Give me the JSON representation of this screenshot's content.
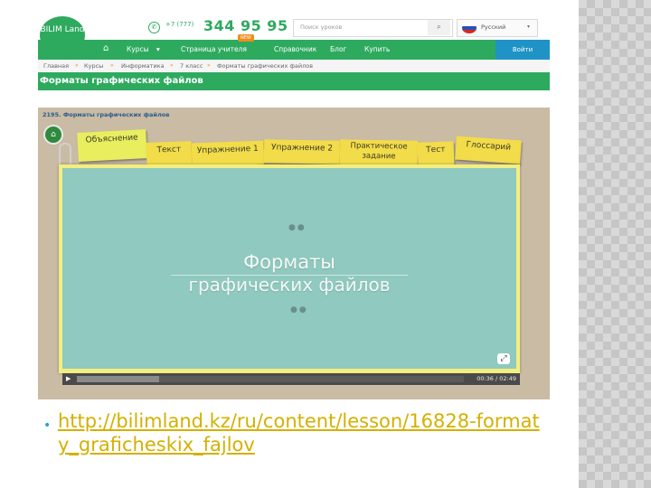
{
  "header": {
    "logo_text": "BILIM Land",
    "phone_prefix": "+7 (777)",
    "phone_number": "344 95 95",
    "search_placeholder": "Поиск уроков",
    "language": "Русский"
  },
  "nav": {
    "items": [
      {
        "label": "Курсы",
        "caret": "▾"
      },
      {
        "label": "Страница учителя",
        "badge": "NEW"
      },
      {
        "label": "Справочник"
      },
      {
        "label": "Блог"
      },
      {
        "label": "Купить"
      }
    ],
    "login_label": "Войти"
  },
  "breadcrumbs": [
    "Главная",
    "Курсы",
    "Информатика",
    "7 класс",
    "Форматы графических файлов"
  ],
  "page_title": "Форматы графических файлов",
  "lesson": {
    "title": "2195. Форматы графических файлов",
    "tabs": [
      {
        "label": "Объяснение",
        "active": true
      },
      {
        "label": "Текст",
        "active": false
      },
      {
        "label": "Упражнение 1",
        "active": false
      },
      {
        "label": "Упражнение 2",
        "active": false
      },
      {
        "label": "Практическое задание",
        "active": false
      },
      {
        "label": "Тест",
        "active": false
      },
      {
        "label": "Глоссарий",
        "active": false
      }
    ],
    "slide": {
      "line1": "Форматы",
      "line2": "графических файлов"
    },
    "player": {
      "time": "00:36 / 02:49",
      "progress": 0.213
    }
  },
  "link_text": "http://bilimland.kz/ru/content/lesson/16828-formaty_graficheskix_fajlov",
  "colors": {
    "brand_green": "#2eaa5f",
    "login_blue": "#1f93c6",
    "tab_yellow": "#f3dc49",
    "slide_teal": "#8fc9bf",
    "link_gold": "#d4b000",
    "bullet_blue": "#2ea0c9"
  },
  "icons": {
    "phone": "phone-icon",
    "search": "search-icon",
    "home": "home-icon",
    "play": "play-icon",
    "fullscreen": "fullscreen-icon"
  }
}
